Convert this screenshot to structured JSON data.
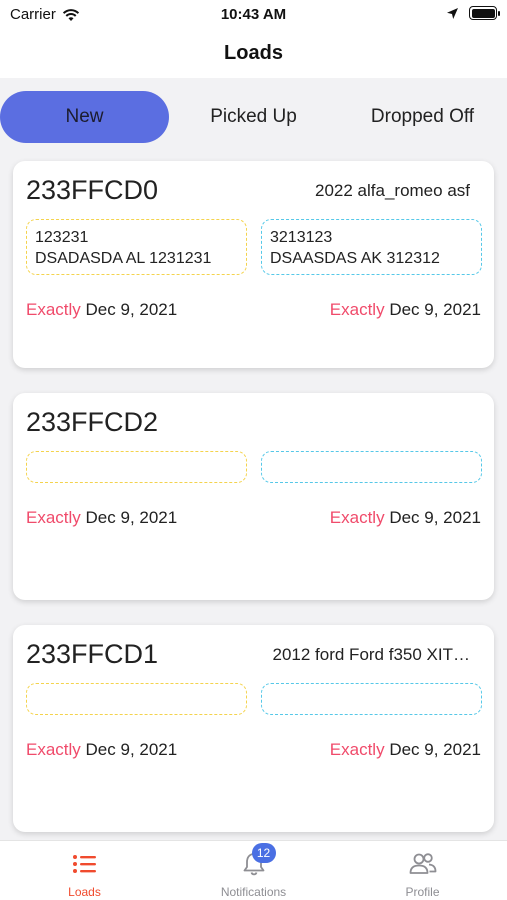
{
  "status_bar": {
    "carrier": "Carrier",
    "time": "10:43 AM"
  },
  "nav": {
    "title": "Loads"
  },
  "tabs": [
    {
      "label": "New",
      "active": true
    },
    {
      "label": "Picked Up",
      "active": false
    },
    {
      "label": "Dropped Off",
      "active": false
    }
  ],
  "loads": [
    {
      "id": "233FFCD0",
      "vehicle": "2022 alfa_romeo asf",
      "pickup": {
        "line1": "123231",
        "line2": "DSADASDA AL 1231231"
      },
      "dropoff": {
        "line1": "3213123",
        "line2": "DSAASDAS AK 312312"
      },
      "pickup_date": {
        "kind": "Exactly",
        "date": "Dec 9, 2021"
      },
      "dropoff_date": {
        "kind": "Exactly",
        "date": "Dec 9, 2021"
      }
    },
    {
      "id": "233FFCD2",
      "vehicle": "",
      "pickup": {
        "line1": "",
        "line2": ""
      },
      "dropoff": {
        "line1": "",
        "line2": ""
      },
      "pickup_date": {
        "kind": "Exactly",
        "date": "Dec 9, 2021"
      },
      "dropoff_date": {
        "kind": "Exactly",
        "date": "Dec 9, 2021"
      }
    },
    {
      "id": "233FFCD1",
      "vehicle": "2012 ford Ford f350 XIT…",
      "pickup": {
        "line1": "",
        "line2": ""
      },
      "dropoff": {
        "line1": "",
        "line2": ""
      },
      "pickup_date": {
        "kind": "Exactly",
        "date": "Dec 9, 2021"
      },
      "dropoff_date": {
        "kind": "Exactly",
        "date": "Dec 9, 2021"
      }
    }
  ],
  "tab_bar": {
    "items": [
      {
        "label": "Loads",
        "icon": "list-icon",
        "active": true
      },
      {
        "label": "Notifications",
        "icon": "bell-icon",
        "badge": "12"
      },
      {
        "label": "Profile",
        "icon": "users-icon"
      }
    ]
  },
  "colors": {
    "accent": "#5b6ee1",
    "date_kind": "#f04b6b",
    "pickup_border": "#f4d34d",
    "dropoff_border": "#56c8e8",
    "active_tab": "#f04b2e",
    "badge": "#4a6fe3"
  }
}
